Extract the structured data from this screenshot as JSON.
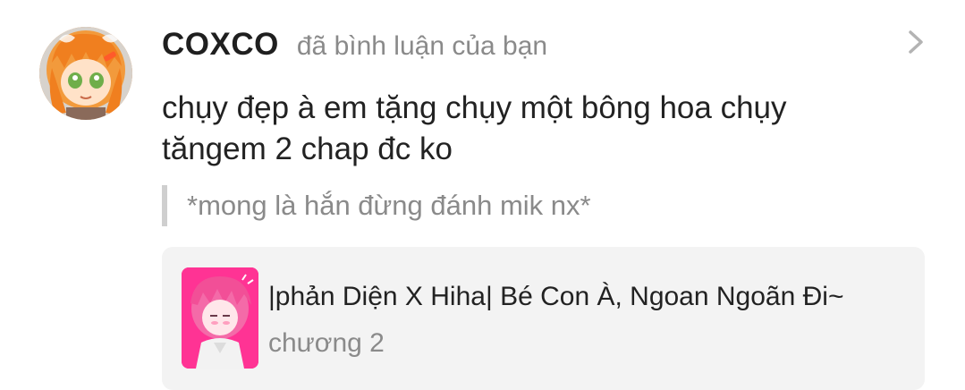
{
  "notification": {
    "username": "COXCO",
    "action": "đã bình luận của bạn",
    "comment": "chụy đẹp à em tặng chụy một bông hoa chụy tăngem 2 chap đc ko",
    "quote": "*mong là hắn đừng đánh mik nx*",
    "story": {
      "title": "|phản Diện X Hiha| Bé Con À, Ngoan Ngoãn Đi~",
      "chapter": "chương 2"
    }
  },
  "icons": {
    "chevron": "chevron-right-icon"
  },
  "colors": {
    "username": "#1f1f1f",
    "secondary_text": "#8a8a8a",
    "card_background": "#f3f3f3",
    "quote_bar": "#cfcfcf"
  }
}
